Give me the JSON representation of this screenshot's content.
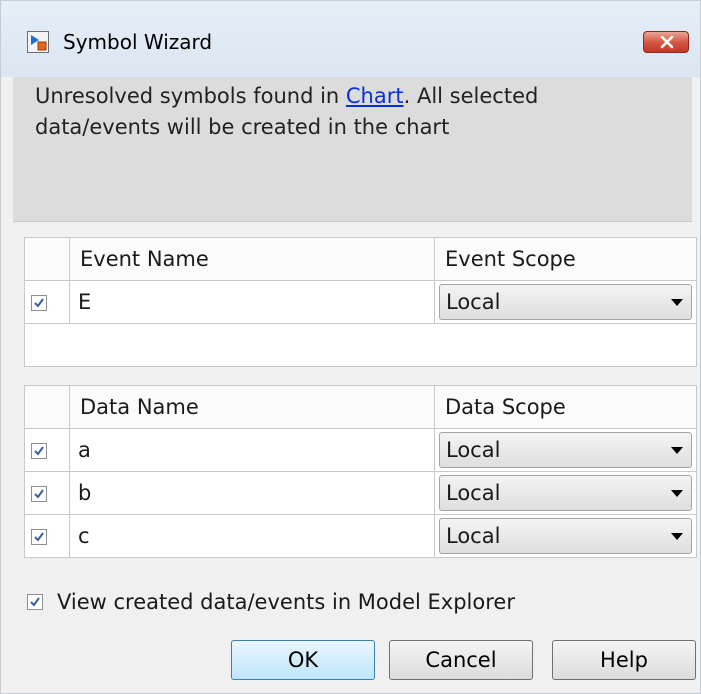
{
  "window": {
    "title": "Symbol Wizard",
    "close_label": "close"
  },
  "message": {
    "prefix": "Unresolved symbols found in ",
    "link": "Chart",
    "suffix": ". All selected data/events will be created in the chart"
  },
  "events_table": {
    "headers": [
      "Event Name",
      "Event Scope"
    ],
    "rows": [
      {
        "checked": true,
        "name": "E",
        "scope": "Local"
      }
    ]
  },
  "data_table": {
    "headers": [
      "Data Name",
      "Data Scope"
    ],
    "rows": [
      {
        "checked": true,
        "name": "a",
        "scope": "Local"
      },
      {
        "checked": true,
        "name": "b",
        "scope": "Local"
      },
      {
        "checked": true,
        "name": "c",
        "scope": "Local"
      }
    ]
  },
  "view_in_explorer": {
    "checked": true,
    "label": "View created data/events in Model Explorer"
  },
  "buttons": {
    "ok": "OK",
    "cancel": "Cancel",
    "help": "Help"
  },
  "colors": {
    "link": "#0b2fd6",
    "close_button": "#d2543f",
    "default_button_border": "#3c7fb1"
  }
}
